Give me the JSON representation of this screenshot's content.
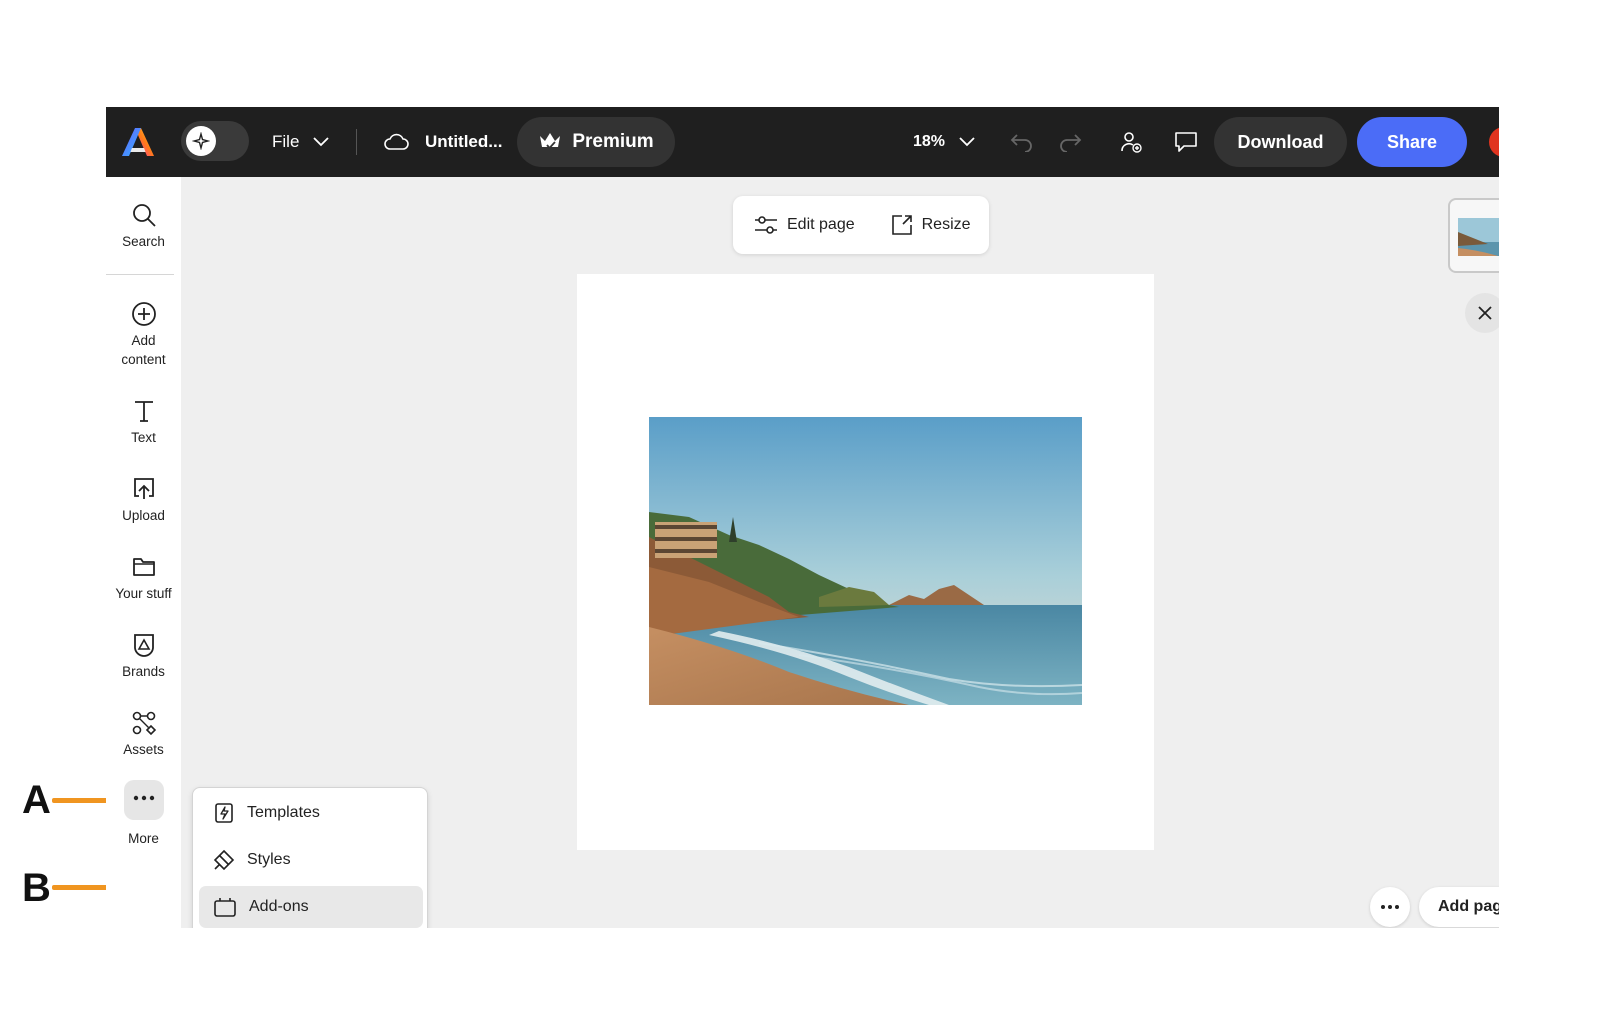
{
  "topbar": {
    "file_label": "File",
    "doc_title": "Untitled...",
    "premium_label": "Premium",
    "zoom_value": "18%",
    "download_label": "Download",
    "share_label": "Share"
  },
  "sidebar": {
    "items": [
      {
        "label": "Search",
        "icon": "search-icon"
      },
      {
        "label": "Add\ncontent",
        "icon": "plus-circle-icon"
      },
      {
        "label": "Text",
        "icon": "text-icon"
      },
      {
        "label": "Upload",
        "icon": "upload-icon"
      },
      {
        "label": "Your stuff",
        "icon": "folder-icon"
      },
      {
        "label": "Brands",
        "icon": "brand-icon"
      },
      {
        "label": "Assets",
        "icon": "assets-icon"
      },
      {
        "label": "More",
        "icon": "more-icon"
      }
    ]
  },
  "page_toolbar": {
    "edit_page_label": "Edit page",
    "resize_label": "Resize"
  },
  "more_menu": {
    "items": [
      {
        "label": "Templates",
        "icon": "templates-icon"
      },
      {
        "label": "Styles",
        "icon": "styles-icon"
      },
      {
        "label": "Add-ons",
        "icon": "addons-icon",
        "active": true
      }
    ]
  },
  "page_controls": {
    "add_page_label": "Add page"
  },
  "annotations": {
    "a": "A",
    "b": "B"
  },
  "colors": {
    "topbar_bg": "#1f1f1f",
    "share_blue": "#4b6cf7",
    "callout_orange": "#f09520"
  }
}
